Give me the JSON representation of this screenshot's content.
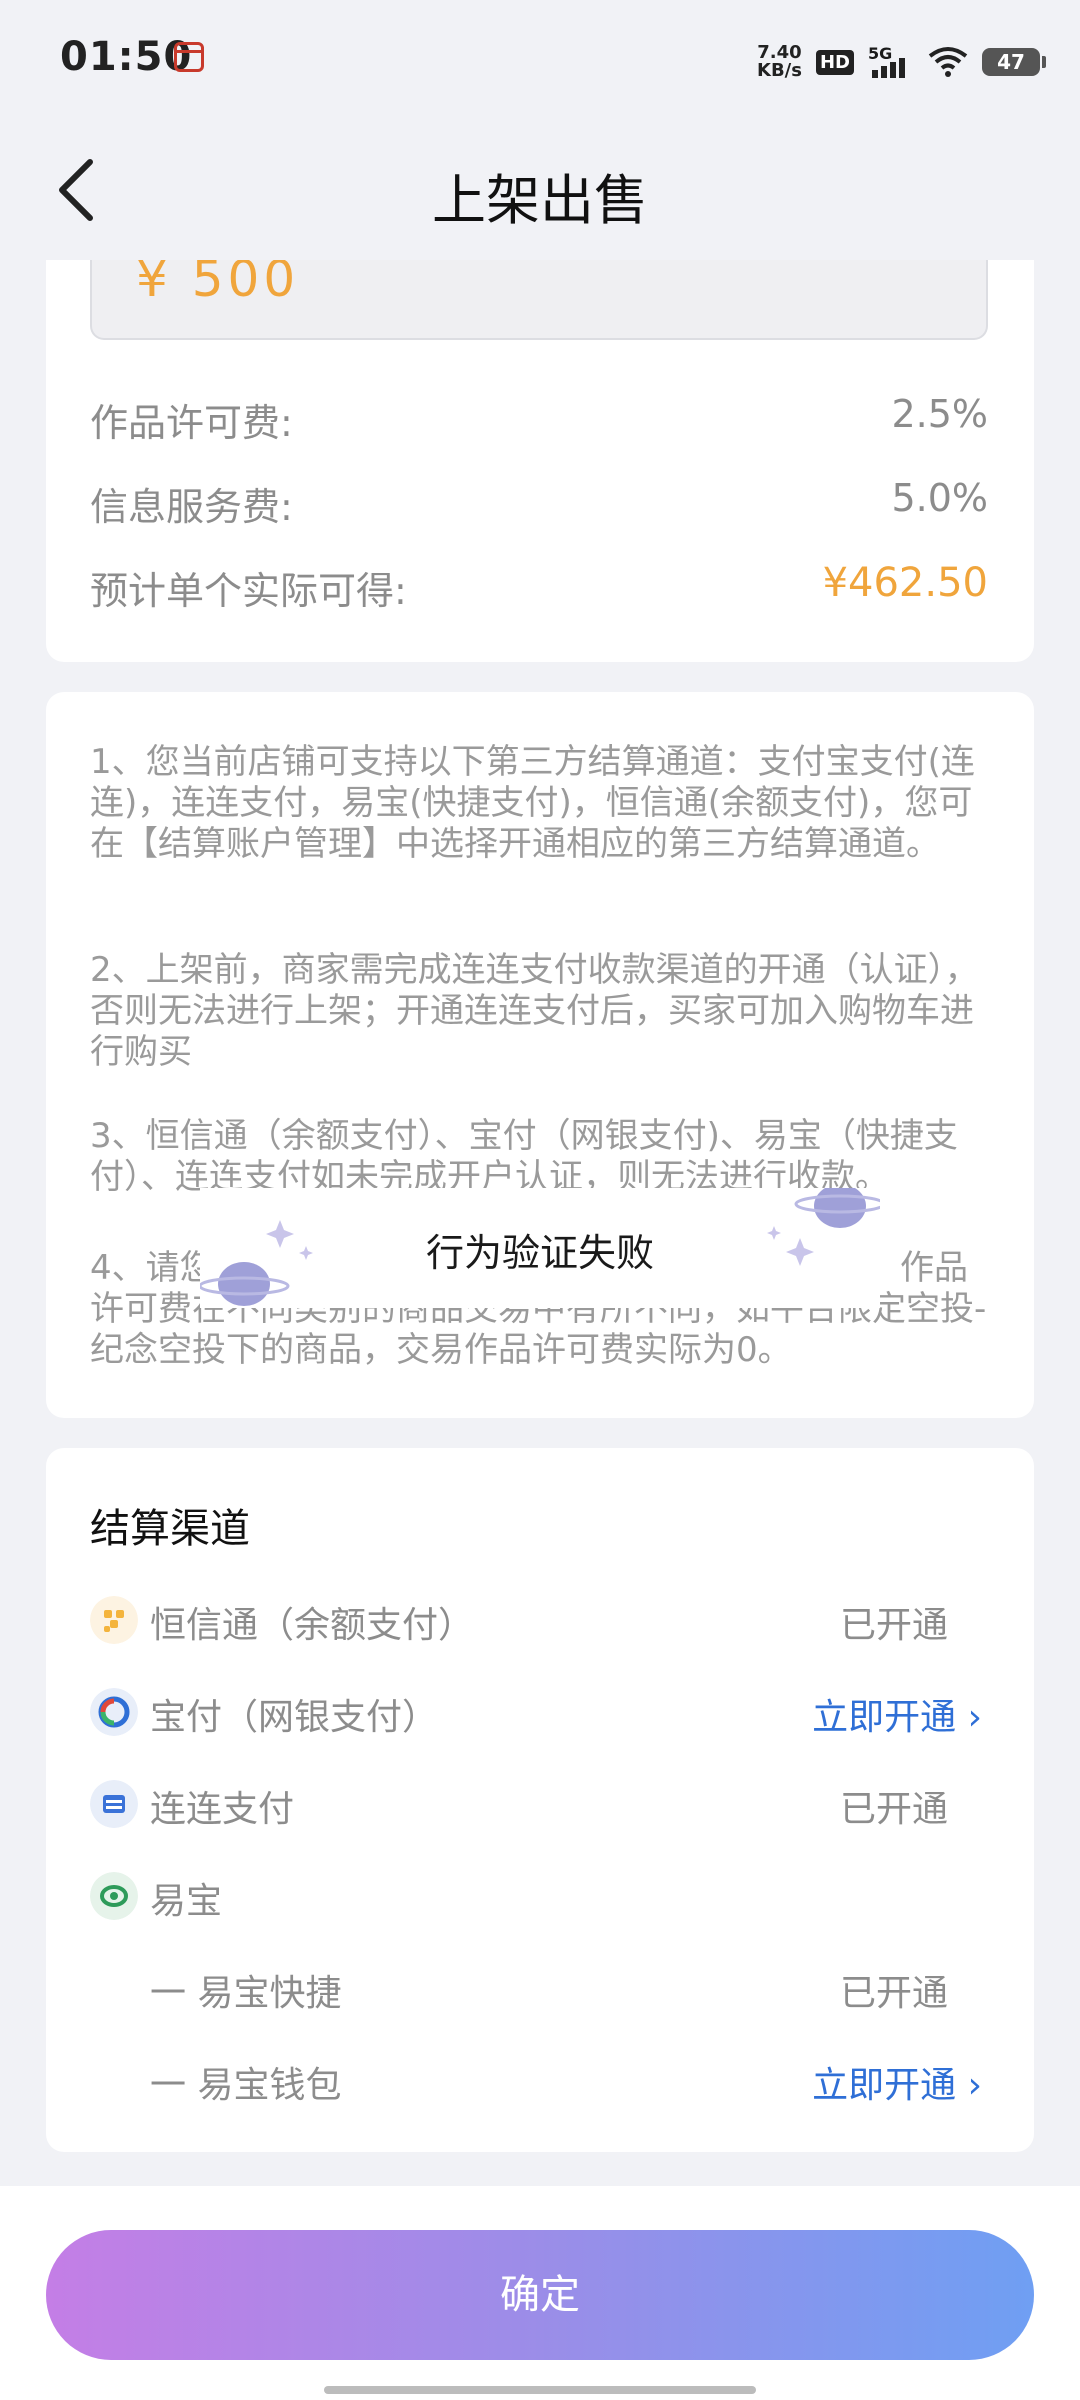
{
  "status_bar": {
    "time": "01:50",
    "net_speed_value": "7.40",
    "net_speed_unit": "KB/s",
    "hd": "HD",
    "signal": "5G",
    "battery": "47"
  },
  "header": {
    "title": "上架出售",
    "back_icon": "chevron-left-icon"
  },
  "price": {
    "value": "¥ 500"
  },
  "fees": [
    {
      "label": "作品许可费:",
      "value": "2.5%"
    },
    {
      "label": "信息服务费:",
      "value": "5.0%"
    },
    {
      "label": "预计单个实际可得:",
      "value": "¥462.50"
    }
  ],
  "notes": [
    "1、您当前店铺可支持以下第三方结算通道：支付宝支付(连连)，连连支付，易宝(快捷支付)，恒信通(余额支付)，您可在【结算账户管理】中选择开通相应的第三方结算通道。",
    "2、上架前，商家需完成连连支付收款渠道的开通（认证），否则无法进行上架；开通连连支付后，买家可加入购物车进行购买",
    "3、恒信通（余额支付）、宝付（网银支付)、易宝（快捷支付）、连连支付如未完成开户认证，则无法进行收款。",
    "4、请您",
    "，作品许可费在不同类别的商品交易中有所不同，如平台限定空投-纪念空投下的商品，交易作品许可费实际为0。"
  ],
  "toast": {
    "message": "行为验证失败"
  },
  "channels": {
    "title": "结算渠道",
    "items": [
      {
        "label": "恒信通（余额支付）",
        "status": "已开通",
        "icon": "hengxintong-icon",
        "icon_color": "#f4b43c"
      },
      {
        "label": "宝付（网银支付）",
        "status": "立即开通",
        "icon": "baofu-icon",
        "icon_color": "#2f6fd6"
      },
      {
        "label": "连连支付",
        "status": "已开通",
        "icon": "lianlian-icon",
        "icon_color": "#3a72d8"
      },
      {
        "label": "易宝",
        "status": "",
        "icon": "yibao-icon",
        "icon_color": "#2e9b5a"
      },
      {
        "label": "一 易宝快捷",
        "status": "已开通"
      },
      {
        "label": "一 易宝钱包",
        "status": "立即开通"
      }
    ]
  },
  "confirm_button": {
    "label": "确定"
  },
  "colors": {
    "accent_orange": "#f0a53c",
    "link_blue": "#2f6fd6",
    "button_gradient_start": "#c47ee6",
    "button_gradient_end": "#6f9ff3"
  }
}
